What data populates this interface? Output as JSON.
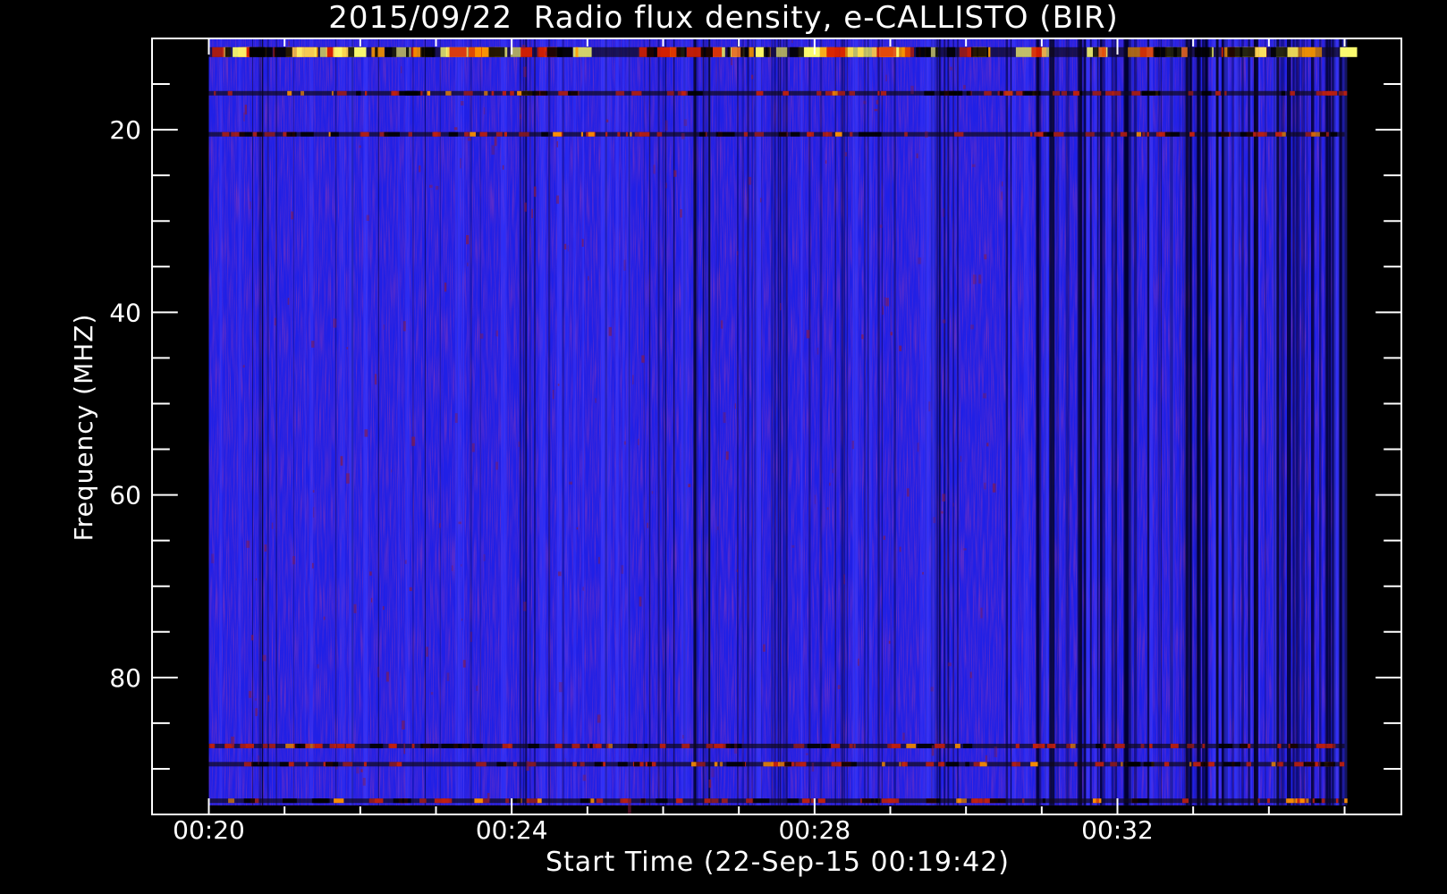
{
  "chart_data": {
    "type": "heatmap",
    "title": "2015/09/22  Radio flux density, e-CALLISTO (BIR)",
    "xlabel": "Start Time (22-Sep-15 00:19:42)",
    "ylabel": "Frequency (MHZ)",
    "x_ticks": [
      "00:20",
      "00:24",
      "00:28",
      "00:32"
    ],
    "x_tick_minutes": [
      20,
      24,
      28,
      32
    ],
    "x_range_minutes": [
      19.25,
      35.75
    ],
    "data_x_range_minutes": [
      20.0,
      35.0
    ],
    "y_ticks": [
      20,
      40,
      60,
      80
    ],
    "y_range": [
      10,
      95
    ],
    "data_y_range": [
      10,
      94
    ],
    "y_inverted": true,
    "colormap": [
      "#000000",
      "#1a1ad8",
      "#3030ff",
      "#7a1a6a",
      "#cc2200",
      "#ff8800",
      "#ffff80"
    ],
    "features": [
      {
        "description_band": "strong RFI",
        "freq_mhz": 11.5,
        "level": "high"
      },
      {
        "description_band": "RFI",
        "freq_mhz": 16,
        "level": "medium"
      },
      {
        "description_band": "RFI",
        "freq_mhz": 20.5,
        "level": "medium"
      },
      {
        "description_band": "RFI",
        "freq_mhz": 87.5,
        "level": "medium"
      },
      {
        "description_band": "RFI",
        "freq_mhz": 89.5,
        "level": "medium"
      },
      {
        "description_band": "RFI",
        "freq_mhz": 93.5,
        "level": "medium"
      }
    ]
  }
}
